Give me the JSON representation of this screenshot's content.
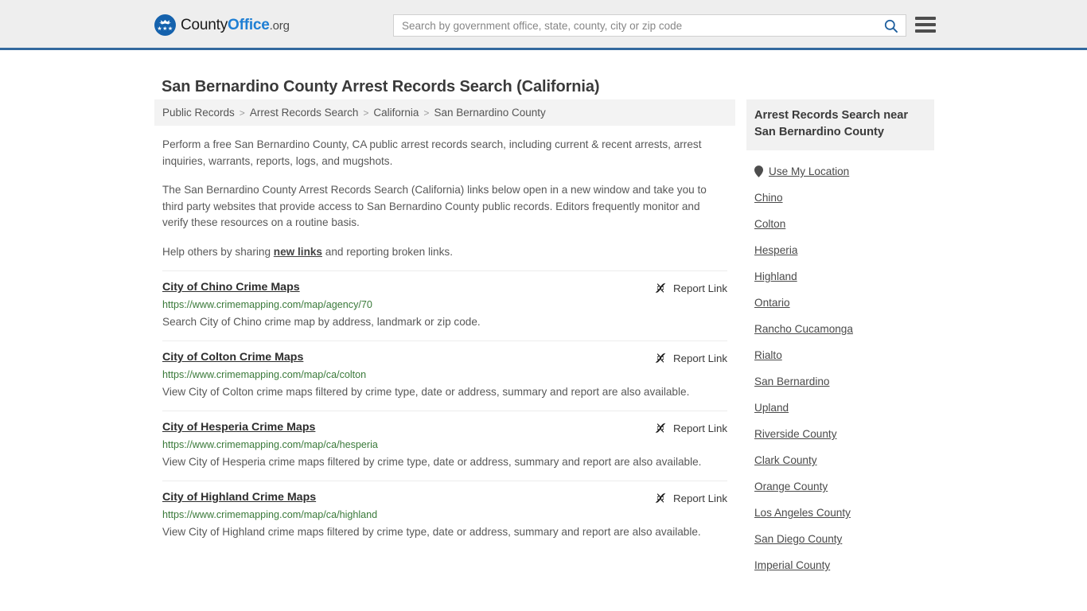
{
  "header": {
    "logo": {
      "name_part1": "County",
      "name_part2": "Office",
      "name_part3": ".org",
      "stars": "★★★"
    },
    "search": {
      "placeholder": "Search by government office, state, county, city or zip code",
      "value": "",
      "search_icon": "search-icon"
    },
    "menu_icon": "hamburger-menu-icon",
    "accent_color": "#33699e"
  },
  "page": {
    "title": "San Bernardino County Arrest Records Search (California)"
  },
  "breadcrumb": {
    "separator": ">",
    "items": [
      {
        "label": "Public Records"
      },
      {
        "label": "Arrest Records Search"
      },
      {
        "label": "California"
      },
      {
        "label": "San Bernardino County"
      }
    ]
  },
  "intro": {
    "paragraph1": "Perform a free San Bernardino County, CA public arrest records search, including current & recent arrests, arrest inquiries, warrants, reports, logs, and mugshots.",
    "paragraph2": "The San Bernardino County Arrest Records Search (California) links below open in a new window and take you to third party websites that provide access to San Bernardino County public records. Editors frequently monitor and verify these resources on a routine basis.",
    "help_prefix": "Help others by sharing ",
    "help_link": "new links",
    "help_suffix": " and reporting broken links."
  },
  "results": {
    "report_label": "Report Link",
    "report_icon": "broken-link-icon",
    "items": [
      {
        "title": "City of Chino Crime Maps",
        "url": "https://www.crimemapping.com/map/agency/70",
        "description": "Search City of Chino crime map by address, landmark or zip code."
      },
      {
        "title": "City of Colton Crime Maps",
        "url": "https://www.crimemapping.com/map/ca/colton",
        "description": "View City of Colton crime maps filtered by crime type, date or address, summary and report are also available."
      },
      {
        "title": "City of Hesperia Crime Maps",
        "url": "https://www.crimemapping.com/map/ca/hesperia",
        "description": "View City of Hesperia crime maps filtered by crime type, date or address, summary and report are also available."
      },
      {
        "title": "City of Highland Crime Maps",
        "url": "https://www.crimemapping.com/map/ca/highland",
        "description": "View City of Highland crime maps filtered by crime type, date or address, summary and report are also available."
      }
    ]
  },
  "sidebar": {
    "heading": "Arrest Records Search near San Bernardino County",
    "location_icon": "map-pin-icon",
    "items": [
      {
        "label": "Use My Location",
        "icon": "map-pin-icon"
      },
      {
        "label": "Chino"
      },
      {
        "label": "Colton"
      },
      {
        "label": "Hesperia"
      },
      {
        "label": "Highland"
      },
      {
        "label": "Ontario"
      },
      {
        "label": "Rancho Cucamonga"
      },
      {
        "label": "Rialto"
      },
      {
        "label": "San Bernardino"
      },
      {
        "label": "Upland"
      },
      {
        "label": "Riverside County"
      },
      {
        "label": "Clark County"
      },
      {
        "label": "Orange County"
      },
      {
        "label": "Los Angeles County"
      },
      {
        "label": "San Diego County"
      },
      {
        "label": "Imperial County"
      }
    ]
  }
}
